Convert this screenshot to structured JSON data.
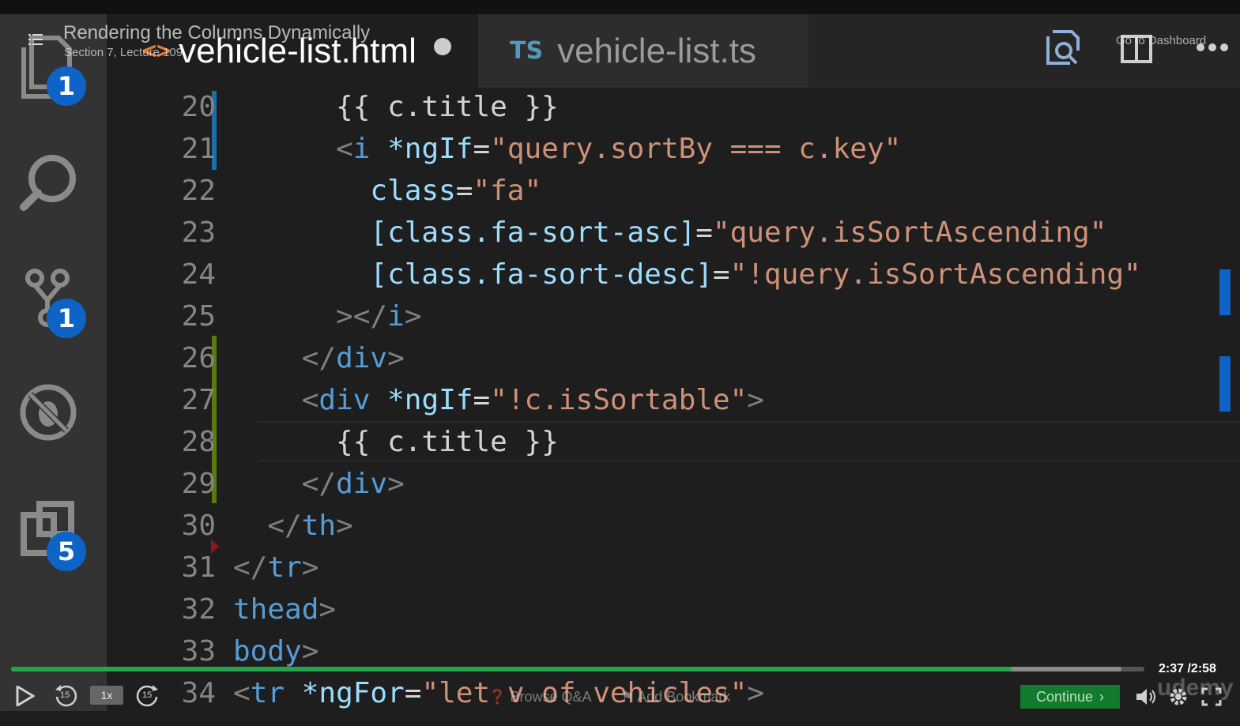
{
  "overlay": {
    "lecture_title": "Rendering the Columns Dynamically",
    "lecture_subtitle": "Section 7, Lecture 109",
    "dashboard_link": "Go to Dashboard"
  },
  "tabs": [
    {
      "label": "vehicle-list.html",
      "icon": "html-file-icon",
      "active": true,
      "dirty": true
    },
    {
      "label": "vehicle-list.ts",
      "icon": "ts-file-icon",
      "badge": "TS",
      "active": false
    }
  ],
  "html_icon_glyph": "<>",
  "activity_bar": {
    "explorer_badge": "1",
    "scm_badge": "1",
    "extensions_badge": "5"
  },
  "editor": {
    "lines": [
      {
        "n": "20",
        "indent": "      ",
        "tokens": [
          [
            "{{ c.title }}",
            "text"
          ]
        ]
      },
      {
        "n": "21",
        "indent": "      ",
        "tokens": [
          [
            "<",
            "punct"
          ],
          [
            "i",
            "tag"
          ],
          [
            " *ngIf",
            "attr"
          ],
          [
            "=",
            "text"
          ],
          [
            "\"query.sortBy === c.key\"",
            "str"
          ]
        ]
      },
      {
        "n": "22",
        "indent": "        ",
        "tokens": [
          [
            "class",
            "attr"
          ],
          [
            "=",
            "text"
          ],
          [
            "\"fa\"",
            "str"
          ]
        ]
      },
      {
        "n": "23",
        "indent": "        ",
        "tokens": [
          [
            "[class.fa-sort-asc]",
            "attr"
          ],
          [
            "=",
            "text"
          ],
          [
            "\"query.isSortAscending\"",
            "str"
          ]
        ]
      },
      {
        "n": "24",
        "indent": "        ",
        "tokens": [
          [
            "[class.fa-sort-desc]",
            "attr"
          ],
          [
            "=",
            "text"
          ],
          [
            "\"!query.isSortAscending\"",
            "str"
          ]
        ]
      },
      {
        "n": "25",
        "indent": "      ",
        "tokens": [
          [
            "></",
            "punct"
          ],
          [
            "i",
            "tag"
          ],
          [
            ">",
            "punct"
          ]
        ]
      },
      {
        "n": "26",
        "indent": "    ",
        "tokens": [
          [
            "</",
            "punct"
          ],
          [
            "div",
            "tag"
          ],
          [
            ">",
            "punct"
          ]
        ]
      },
      {
        "n": "27",
        "indent": "    ",
        "tokens": [
          [
            "<",
            "punct"
          ],
          [
            "div",
            "tag"
          ],
          [
            " *ngIf",
            "attr"
          ],
          [
            "=",
            "text"
          ],
          [
            "\"!c.isSortable\"",
            "str"
          ],
          [
            ">",
            "punct"
          ]
        ]
      },
      {
        "n": "28",
        "indent": "      ",
        "tokens": [
          [
            "{{ c.title }}",
            "text"
          ]
        ]
      },
      {
        "n": "29",
        "indent": "    ",
        "tokens": [
          [
            "</",
            "punct"
          ],
          [
            "div",
            "tag"
          ],
          [
            ">",
            "punct"
          ]
        ]
      },
      {
        "n": "30",
        "indent": "  ",
        "tokens": [
          [
            "</",
            "punct"
          ],
          [
            "th",
            "tag"
          ],
          [
            ">",
            "punct"
          ]
        ]
      },
      {
        "n": "31",
        "indent": "",
        "tokens": [
          [
            "</",
            "punct"
          ],
          [
            "tr",
            "tag"
          ],
          [
            ">",
            "punct"
          ]
        ]
      },
      {
        "n": "32",
        "indent": "",
        "tokens": [
          [
            "thead",
            "tag"
          ],
          [
            ">",
            "punct"
          ]
        ]
      },
      {
        "n": "33",
        "indent": "",
        "tokens": [
          [
            "body",
            "tag"
          ],
          [
            ">",
            "punct"
          ]
        ]
      },
      {
        "n": "34",
        "indent": "",
        "tokens": [
          [
            "<",
            "punct"
          ],
          [
            "tr",
            "tag"
          ],
          [
            " *ngFor",
            "attr"
          ],
          [
            "=",
            "text"
          ],
          [
            "\"let v of vehicles\"",
            "str"
          ],
          [
            ">",
            "punct"
          ]
        ]
      }
    ],
    "colors": {
      "punct": "#808080",
      "tag": "#569cd6",
      "attr": "#9cdcfe",
      "str": "#ce9178",
      "text": "#d4d4d4"
    }
  },
  "player": {
    "current_time": "2:37",
    "duration": "/2:58",
    "progress": 0.883,
    "buffered": 0.98,
    "speed": "1x",
    "rewind_label": "15",
    "forward_label": "15",
    "browse_qa": "Browse Q&A",
    "add_bookmark": "Add Bookmark",
    "continue": "Continue",
    "brand": "udemy"
  }
}
